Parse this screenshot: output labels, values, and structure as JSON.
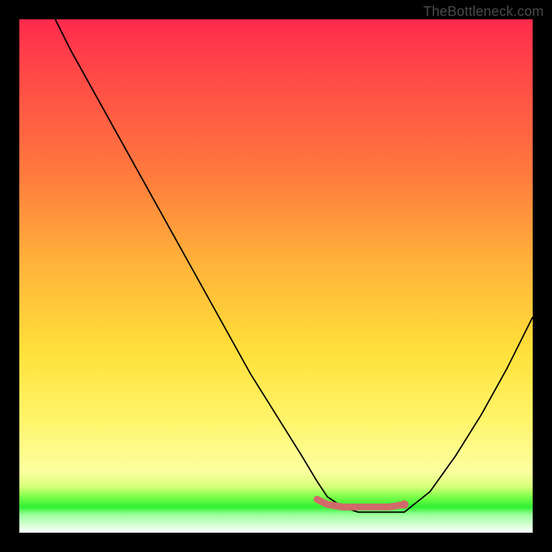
{
  "watermark": "TheBottleneck.com",
  "chart_data": {
    "type": "line",
    "title": "",
    "xlabel": "",
    "ylabel": "",
    "xlim": [
      0,
      100
    ],
    "ylim": [
      0,
      100
    ],
    "grid": false,
    "legend": false,
    "series": [
      {
        "name": "bottleneck-curve",
        "x": [
          7,
          10,
          15,
          20,
          25,
          30,
          35,
          40,
          45,
          50,
          55,
          58,
          60,
          63,
          66,
          70,
          72,
          75,
          80,
          85,
          90,
          95,
          100
        ],
        "values": [
          100,
          94,
          85,
          76,
          67,
          58,
          49,
          40,
          31,
          23,
          15,
          10,
          7,
          5,
          4,
          4,
          4,
          4,
          8,
          15,
          23,
          32,
          42
        ],
        "stroke": "#000000",
        "stroke_width": 2
      },
      {
        "name": "flat-bottom-marker",
        "x": [
          58,
          60,
          63,
          66,
          70,
          72,
          75
        ],
        "values": [
          6.5,
          5.5,
          5,
          5,
          5,
          5,
          5.5
        ],
        "stroke": "#d16a6a",
        "stroke_width": 10,
        "linecap": "round"
      }
    ],
    "markers": [
      {
        "name": "end-dot",
        "x": 75,
        "y": 5.5,
        "r": 6,
        "fill": "#d16a6a"
      }
    ]
  }
}
